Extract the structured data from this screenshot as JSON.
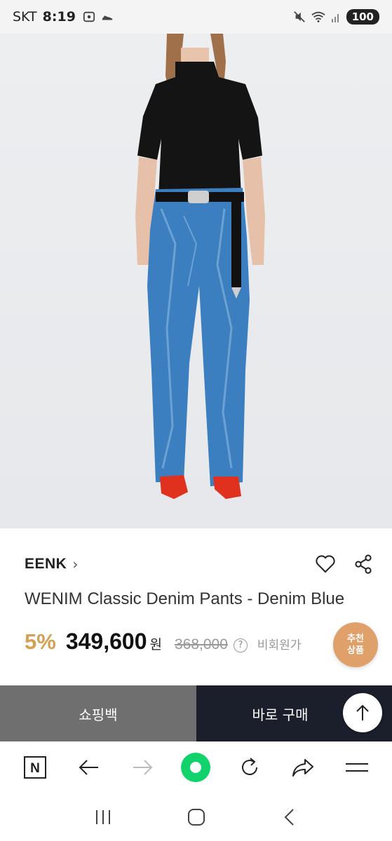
{
  "status_bar": {
    "carrier": "SKT",
    "time": "8:19",
    "battery": "100",
    "icons": [
      "screenshot-icon",
      "shoe-icon",
      "mute-icon",
      "wifi-icon",
      "signal-icon"
    ]
  },
  "product": {
    "image_alt": "model-wearing-denim-pants",
    "brand": "EENK",
    "brand_chevron": "›",
    "title": "WENIM Classic Denim Pants - Denim Blue",
    "discount": "5%",
    "price": "349,600",
    "currency": "원",
    "original_price": "368,000",
    "help": "?",
    "nonmember_text": "비회원가",
    "recommend_line1": "추천",
    "recommend_line2": "상품",
    "colors": {
      "discount": "#d4a055",
      "recommend": "#dfa06a"
    }
  },
  "actions": {
    "cart": "쇼핑백",
    "buy": "바로 구매"
  },
  "toolbar": {
    "items": [
      "naver-n-icon",
      "back-arrow-icon",
      "forward-arrow-icon",
      "green-home-icon",
      "refresh-icon",
      "share-icon",
      "menu-icon"
    ],
    "n_label": "N"
  },
  "system_nav": [
    "recent-apps-icon",
    "home-icon",
    "back-icon"
  ]
}
